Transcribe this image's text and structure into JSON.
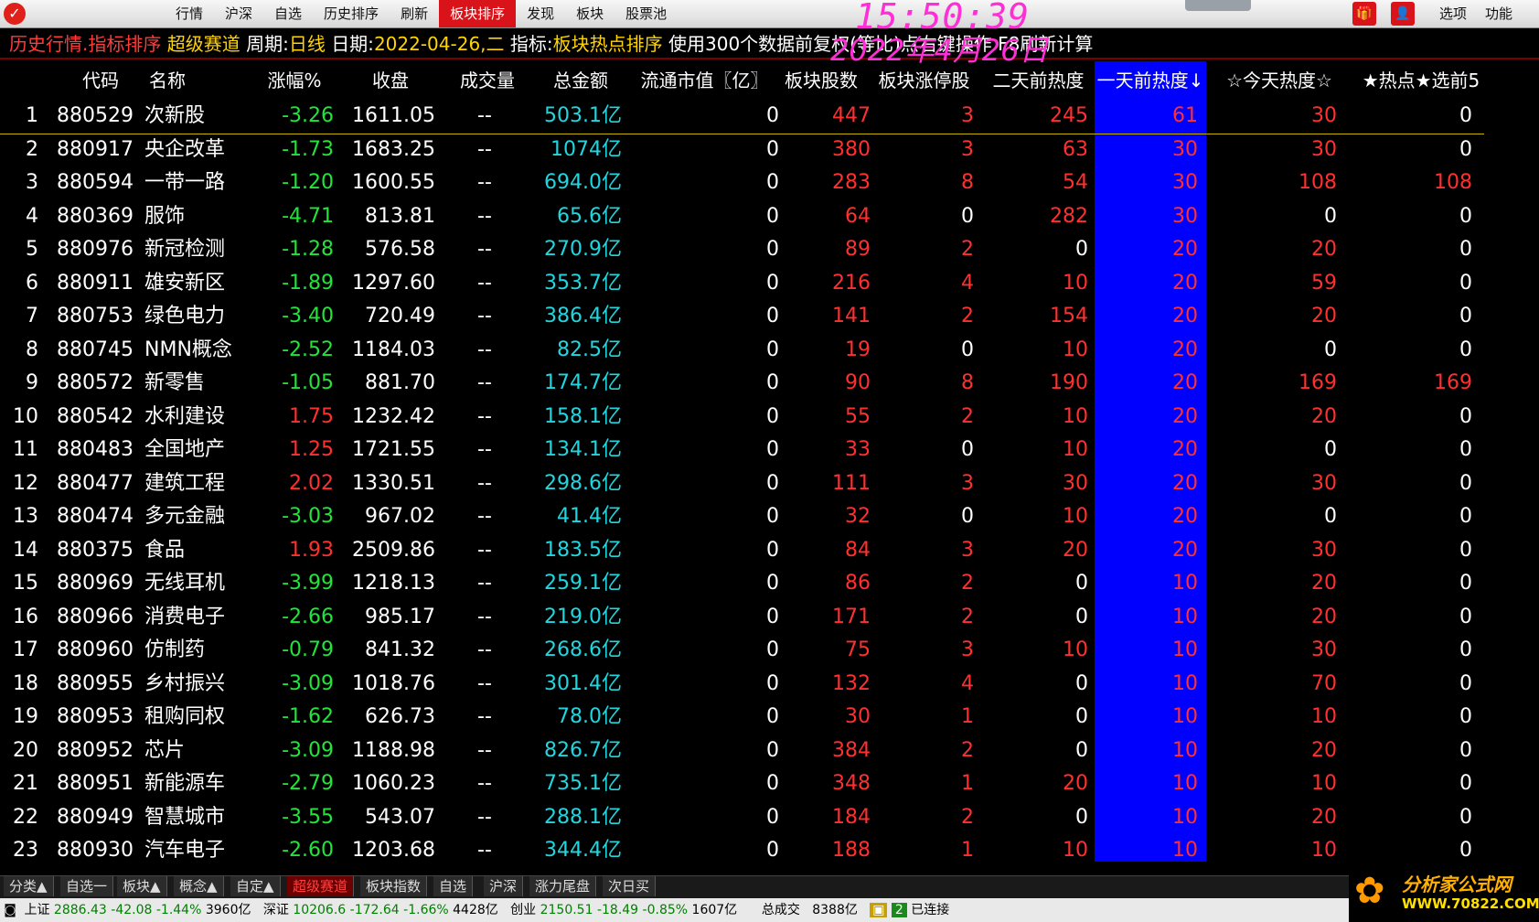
{
  "topbar": {
    "menu": [
      {
        "label": "行情",
        "active": false
      },
      {
        "label": "沪深",
        "active": false
      },
      {
        "label": "自选",
        "active": false
      },
      {
        "label": "历史排序",
        "active": false
      },
      {
        "label": "刷新",
        "active": false
      },
      {
        "label": "板块排序",
        "active": true
      },
      {
        "label": "发现",
        "active": false
      },
      {
        "label": "板块",
        "active": false
      },
      {
        "label": "股票池",
        "active": false
      }
    ],
    "clock": "15:50:39",
    "clock_date": "2022年4月26日",
    "options_label": "选项",
    "function_label": "功能"
  },
  "infobar": {
    "title": "历史行情.指标排序",
    "channel": "超级赛道",
    "period_label": "周期:",
    "period_value": "日线",
    "date_label": "日期:",
    "date_value": "2022-04-26,二",
    "indicator_label": "指标:",
    "indicator_value": "板块热点排序",
    "hint": "使用300个数据前复权(等比)点右键操作 F8刷新计算"
  },
  "table": {
    "headers": [
      "代码",
      "名称",
      "涨幅%",
      "收盘",
      "成交量",
      "总金额",
      "流通市值〖亿〗",
      "板块股数",
      "板块涨停股",
      "二天前热度",
      "一天前热度↓",
      "☆今天热度☆",
      "★热点★选前5"
    ],
    "rows": [
      [
        "1",
        "880529",
        "次新股",
        "-3.26",
        "1611.05",
        "--",
        "503.1亿",
        "0",
        "447",
        "3",
        "245",
        "61",
        "30",
        "0"
      ],
      [
        "2",
        "880917",
        "央企改革",
        "-1.73",
        "1683.25",
        "--",
        "1074亿",
        "0",
        "380",
        "3",
        "63",
        "30",
        "30",
        "0"
      ],
      [
        "3",
        "880594",
        "一带一路",
        "-1.20",
        "1600.55",
        "--",
        "694.0亿",
        "0",
        "283",
        "8",
        "54",
        "30",
        "108",
        "108"
      ],
      [
        "4",
        "880369",
        "服饰",
        "-4.71",
        "813.81",
        "--",
        "65.6亿",
        "0",
        "64",
        "0",
        "282",
        "30",
        "0",
        "0"
      ],
      [
        "5",
        "880976",
        "新冠检测",
        "-1.28",
        "576.58",
        "--",
        "270.9亿",
        "0",
        "89",
        "2",
        "0",
        "20",
        "20",
        "0"
      ],
      [
        "6",
        "880911",
        "雄安新区",
        "-1.89",
        "1297.60",
        "--",
        "353.7亿",
        "0",
        "216",
        "4",
        "10",
        "20",
        "59",
        "0"
      ],
      [
        "7",
        "880753",
        "绿色电力",
        "-3.40",
        "720.49",
        "--",
        "386.4亿",
        "0",
        "141",
        "2",
        "154",
        "20",
        "20",
        "0"
      ],
      [
        "8",
        "880745",
        "NMN概念",
        "-2.52",
        "1184.03",
        "--",
        "82.5亿",
        "0",
        "19",
        "0",
        "10",
        "20",
        "0",
        "0"
      ],
      [
        "9",
        "880572",
        "新零售",
        "-1.05",
        "881.70",
        "--",
        "174.7亿",
        "0",
        "90",
        "8",
        "190",
        "20",
        "169",
        "169"
      ],
      [
        "10",
        "880542",
        "水利建设",
        "1.75",
        "1232.42",
        "--",
        "158.1亿",
        "0",
        "55",
        "2",
        "10",
        "20",
        "20",
        "0"
      ],
      [
        "11",
        "880483",
        "全国地产",
        "1.25",
        "1721.55",
        "--",
        "134.1亿",
        "0",
        "33",
        "0",
        "10",
        "20",
        "0",
        "0"
      ],
      [
        "12",
        "880477",
        "建筑工程",
        "2.02",
        "1330.51",
        "--",
        "298.6亿",
        "0",
        "111",
        "3",
        "30",
        "20",
        "30",
        "0"
      ],
      [
        "13",
        "880474",
        "多元金融",
        "-3.03",
        "967.02",
        "--",
        "41.4亿",
        "0",
        "32",
        "0",
        "10",
        "20",
        "0",
        "0"
      ],
      [
        "14",
        "880375",
        "食品",
        "1.93",
        "2509.86",
        "--",
        "183.5亿",
        "0",
        "84",
        "3",
        "20",
        "20",
        "30",
        "0"
      ],
      [
        "15",
        "880969",
        "无线耳机",
        "-3.99",
        "1218.13",
        "--",
        "259.1亿",
        "0",
        "86",
        "2",
        "0",
        "10",
        "20",
        "0"
      ],
      [
        "16",
        "880966",
        "消费电子",
        "-2.66",
        "985.17",
        "--",
        "219.0亿",
        "0",
        "171",
        "2",
        "0",
        "10",
        "20",
        "0"
      ],
      [
        "17",
        "880960",
        "仿制药",
        "-0.79",
        "841.32",
        "--",
        "268.6亿",
        "0",
        "75",
        "3",
        "10",
        "10",
        "30",
        "0"
      ],
      [
        "18",
        "880955",
        "乡村振兴",
        "-3.09",
        "1018.76",
        "--",
        "301.4亿",
        "0",
        "132",
        "4",
        "0",
        "10",
        "70",
        "0"
      ],
      [
        "19",
        "880953",
        "租购同权",
        "-1.62",
        "626.73",
        "--",
        "78.0亿",
        "0",
        "30",
        "1",
        "0",
        "10",
        "10",
        "0"
      ],
      [
        "20",
        "880952",
        "芯片",
        "-3.09",
        "1188.98",
        "--",
        "826.7亿",
        "0",
        "384",
        "2",
        "0",
        "10",
        "20",
        "0"
      ],
      [
        "21",
        "880951",
        "新能源车",
        "-2.79",
        "1060.23",
        "--",
        "735.1亿",
        "0",
        "348",
        "1",
        "20",
        "10",
        "10",
        "0"
      ],
      [
        "22",
        "880949",
        "智慧城市",
        "-3.55",
        "543.07",
        "--",
        "288.1亿",
        "0",
        "184",
        "2",
        "0",
        "10",
        "20",
        "0"
      ],
      [
        "23",
        "880930",
        "汽车电子",
        "-2.60",
        "1203.68",
        "--",
        "344.4亿",
        "0",
        "188",
        "1",
        "10",
        "10",
        "10",
        "0"
      ]
    ]
  },
  "tabs": [
    {
      "label": "分类▲",
      "active": false
    },
    {
      "label": "自选一",
      "active": false
    },
    {
      "label": "板块▲",
      "active": false
    },
    {
      "label": "概念▲",
      "active": false
    },
    {
      "label": "自定▲",
      "active": false
    },
    {
      "label": "超级赛道",
      "active": true
    },
    {
      "label": "板块指数",
      "active": false
    },
    {
      "label": "自选",
      "active": false
    },
    {
      "label": "沪深",
      "active": false
    },
    {
      "label": "涨力尾盘",
      "active": false
    },
    {
      "label": "次日买",
      "active": false
    }
  ],
  "status": {
    "sh_label": "上证",
    "sh_value": "2886.43",
    "sh_change": "-42.08",
    "sh_pct": "-1.44%",
    "sh_amount": "3960亿",
    "sz_label": "深证",
    "sz_value": "10206.6",
    "sz_change": "-172.64",
    "sz_pct": "-1.66%",
    "sz_amount": "4428亿",
    "cy_label": "创业",
    "cy_value": "2150.51",
    "cy_change": "-18.49",
    "cy_pct": "-0.85%",
    "cy_amount": "1607亿",
    "total_label": "总成交",
    "total_amount": "8388亿",
    "conn_count": "2",
    "conn_label": "已连接"
  },
  "brand": {
    "name": "分析家公式网",
    "url": "WWW.70822.COM"
  }
}
